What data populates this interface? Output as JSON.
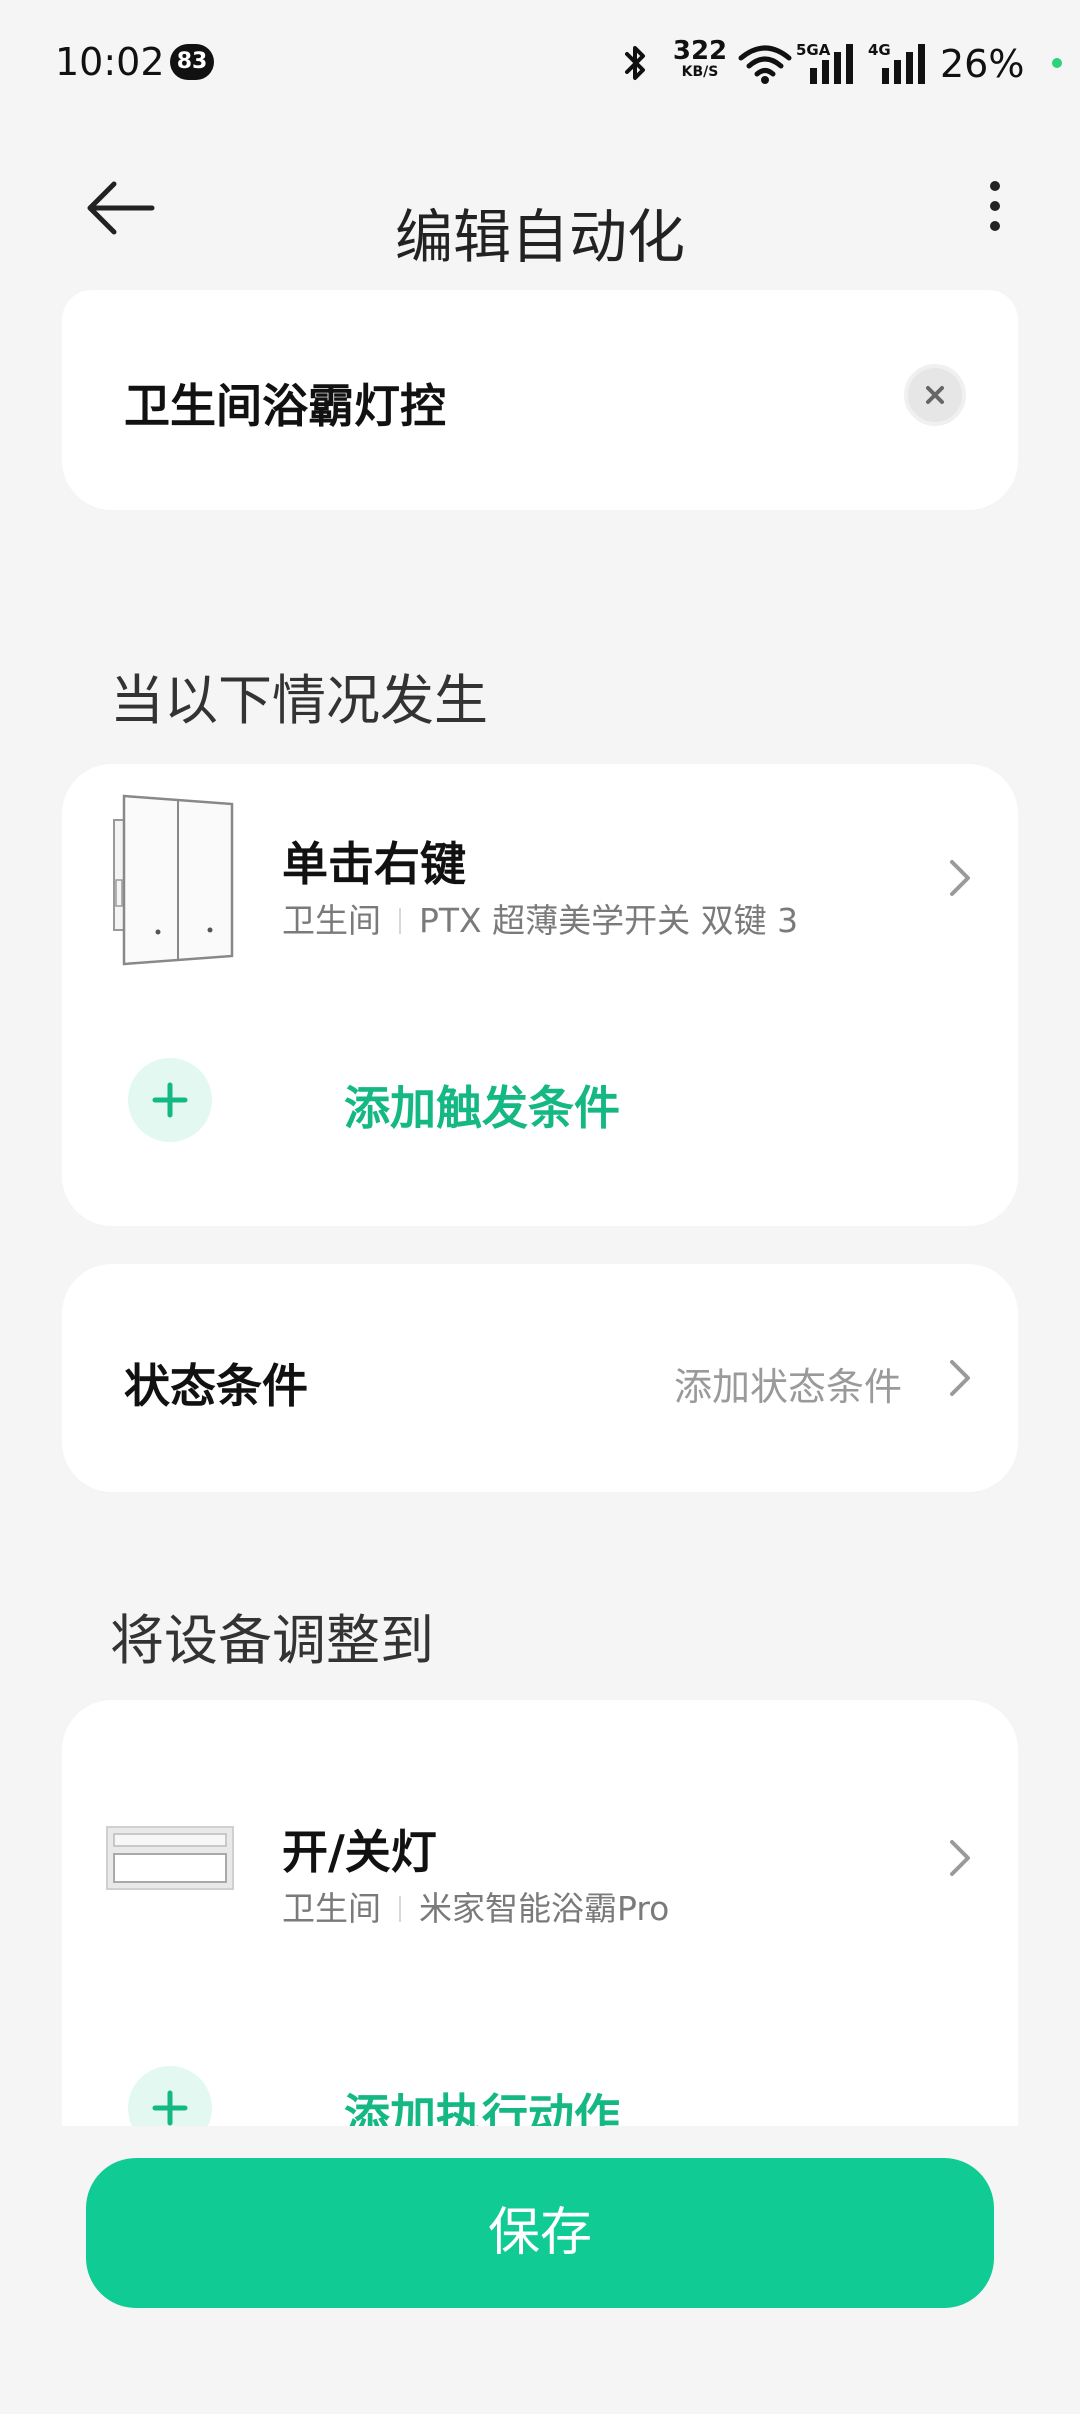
{
  "status_bar": {
    "time": "10:02",
    "notification_count": "83",
    "net_speed_value": "322",
    "net_speed_unit": "KB/S",
    "signal_1_label": "5GA",
    "signal_2_label": "4G",
    "battery": "26%",
    "icons": [
      "bluetooth-icon",
      "wifi-icon",
      "signal-icon",
      "signal-icon"
    ]
  },
  "header": {
    "title": "编辑自动化",
    "icons": [
      "back-arrow-icon",
      "more-vertical-icon"
    ]
  },
  "automation_name": {
    "value": "卫生间浴霸灯控",
    "clear_icon": "close-icon"
  },
  "trigger_section": {
    "title": "当以下情况发生",
    "items": [
      {
        "title": "单击右键",
        "room": "卫生间",
        "device": "PTX 超薄美学开关 双键 3",
        "image": "double-switch-device-icon"
      }
    ],
    "add_label": "添加触发条件"
  },
  "state_condition": {
    "label": "状态条件",
    "hint": "添加状态条件"
  },
  "action_section": {
    "title": "将设备调整到",
    "items": [
      {
        "title": "开/关灯",
        "room": "卫生间",
        "device": "米家智能浴霸Pro",
        "image": "bath-heater-device-icon"
      }
    ],
    "add_label": "添加执行动作"
  },
  "save_label": "保存",
  "colors": {
    "accent": "#10cb94",
    "accent_text": "#15b883",
    "accent_light": "#e3f8f0",
    "background": "#f5f5f5"
  }
}
